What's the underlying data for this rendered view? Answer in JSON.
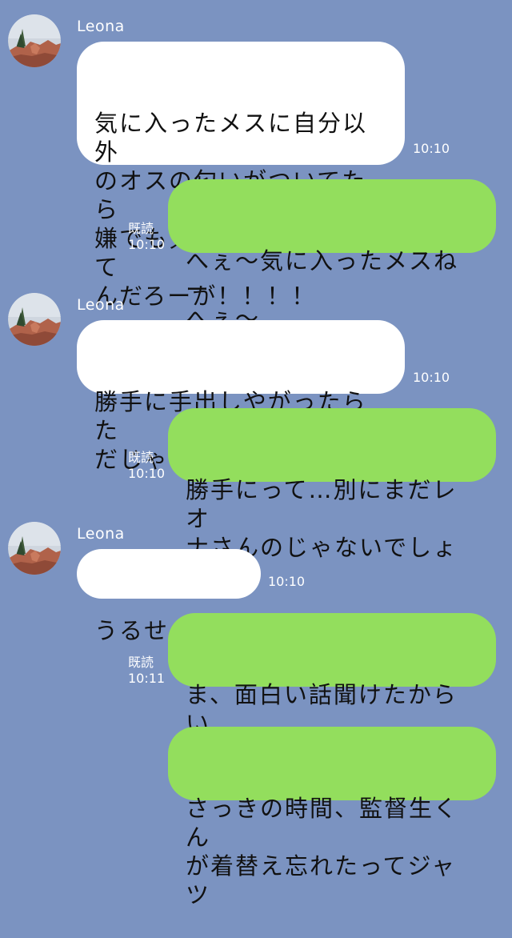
{
  "conversation": {
    "messages": [
      {
        "direction": "incoming",
        "sender": "Leona",
        "text": "気に入ったメスに自分以外\nのオスの匂いがついてたら\n嫌でも気になるに決まって\nんだろーが！！！！",
        "time": "10:10"
      },
      {
        "direction": "outgoing",
        "text": "へぇ〜気に入ったメスねー\nへぇ〜",
        "read_label": "既読",
        "time": "10:10"
      },
      {
        "direction": "incoming",
        "sender": "Leona",
        "text": "勝手に手出しやがったらた\nだじゃおかねぇからな",
        "time": "10:10"
      },
      {
        "direction": "outgoing",
        "text": "勝手にって…別にまだレオ\nナさんのじゃないでしょ",
        "read_label": "既読",
        "time": "10:10"
      },
      {
        "direction": "incoming",
        "sender": "Leona",
        "text": "うるせぇ！！",
        "time": "10:10"
      },
      {
        "direction": "outgoing",
        "text": "ま、面白い話聞けたからい\nっすけど",
        "read_label": "既読",
        "time": "10:11"
      },
      {
        "direction": "outgoing",
        "text": "さっきの時間、監督生くん\nが着替え忘れたってジャツ"
      }
    ]
  },
  "colors": {
    "background": "#7b93c1",
    "incoming_bubble": "#ffffff",
    "outgoing_bubble": "#93de5d",
    "meta_text": "#ffffff"
  }
}
